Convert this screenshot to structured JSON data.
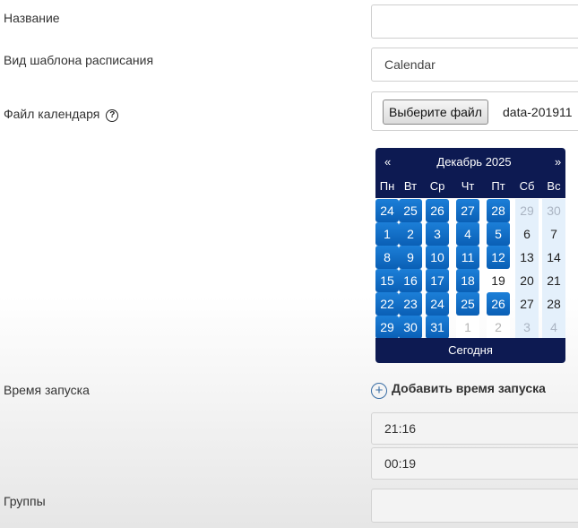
{
  "form": {
    "name_label": "Название",
    "name_value": "",
    "template_label": "Вид шаблона расписания",
    "template_value": "Calendar",
    "file_label": "Файл календаря",
    "help_icon": "question-circle-icon",
    "file_button": "Выберите файл",
    "file_name": "data-201911",
    "start_time_label": "Время запуска",
    "add_time_label": "Добавить время запуска",
    "add_icon": "plus-circle-icon",
    "times": [
      "21:16",
      "00:19"
    ],
    "groups_label": "Группы",
    "groups_value": ""
  },
  "calendar": {
    "prev": "«",
    "next": "»",
    "title": "Декабрь 2025",
    "weekdays": [
      "Пн",
      "Вт",
      "Ср",
      "Чт",
      "Пт",
      "Сб",
      "Вс"
    ],
    "weeks": [
      [
        "24",
        "25",
        "26",
        "27",
        "28",
        "29",
        "30"
      ],
      [
        "1",
        "2",
        "3",
        "4",
        "5",
        "6",
        "7"
      ],
      [
        "8",
        "9",
        "10",
        "11",
        "12",
        "13",
        "14"
      ],
      [
        "15",
        "16",
        "17",
        "18",
        "19",
        "20",
        "21"
      ],
      [
        "22",
        "23",
        "24",
        "25",
        "26",
        "27",
        "28"
      ],
      [
        "29",
        "30",
        "31",
        "1",
        "2",
        "3",
        "4"
      ]
    ],
    "today_button": "Сегодня",
    "colors": {
      "header": "#0d1a52",
      "highlight": "#1c7fd8",
      "weekend_bg": "#e4f0fb"
    }
  }
}
